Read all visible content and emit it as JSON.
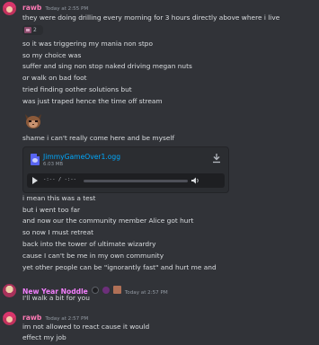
{
  "colors": {
    "background": "#313338",
    "rawb_name": "#ff7ab6",
    "nyn_name": "#f47fff",
    "timestamp": "#949ba4",
    "link": "#00a8fc"
  },
  "messages": [
    {
      "author": "rawb",
      "timestamp": "Today at 2:55 PM",
      "lines": [
        "they were doing drilling every morning for 3 hours directly above where i live"
      ],
      "reaction": {
        "icon": "sticker-emoji-icon",
        "count": "2"
      },
      "lines_after_reaction": [
        "so it was triggering my mania non stpo",
        "so my choice was",
        "suffer and sing non stop naked driving megan nuts",
        "or walk on bad foot",
        "tried finding oother solutions but",
        "was just traped hence the time off stream"
      ],
      "emoji": "cat-emoji-icon",
      "lines_after_emoji": [
        "shame i can't really come here and be myself"
      ],
      "attachment": {
        "filename": "JimmyGameOver1.ogg",
        "size": "6.03 MB",
        "time": "-:-- / -:--"
      },
      "lines_after_attachment": [
        "i mean this was a test",
        "but i went too far",
        "and now our the community member Alice got hurt",
        "so now I must retreat",
        "back into the tower of ultimate wizardry",
        "cause I can't be me in my own community",
        "yet other people can be \"ignorantly fast\" and hurt me and"
      ]
    },
    {
      "author": "New Year Noddle",
      "timestamp": "Today at 2:57 PM",
      "lines": [
        "I'll walk a bit for you"
      ]
    },
    {
      "author": "rawb",
      "timestamp": "Today at 2:57 PM",
      "lines": [
        "im not allowed to react cause it would",
        "effect my job"
      ]
    }
  ]
}
